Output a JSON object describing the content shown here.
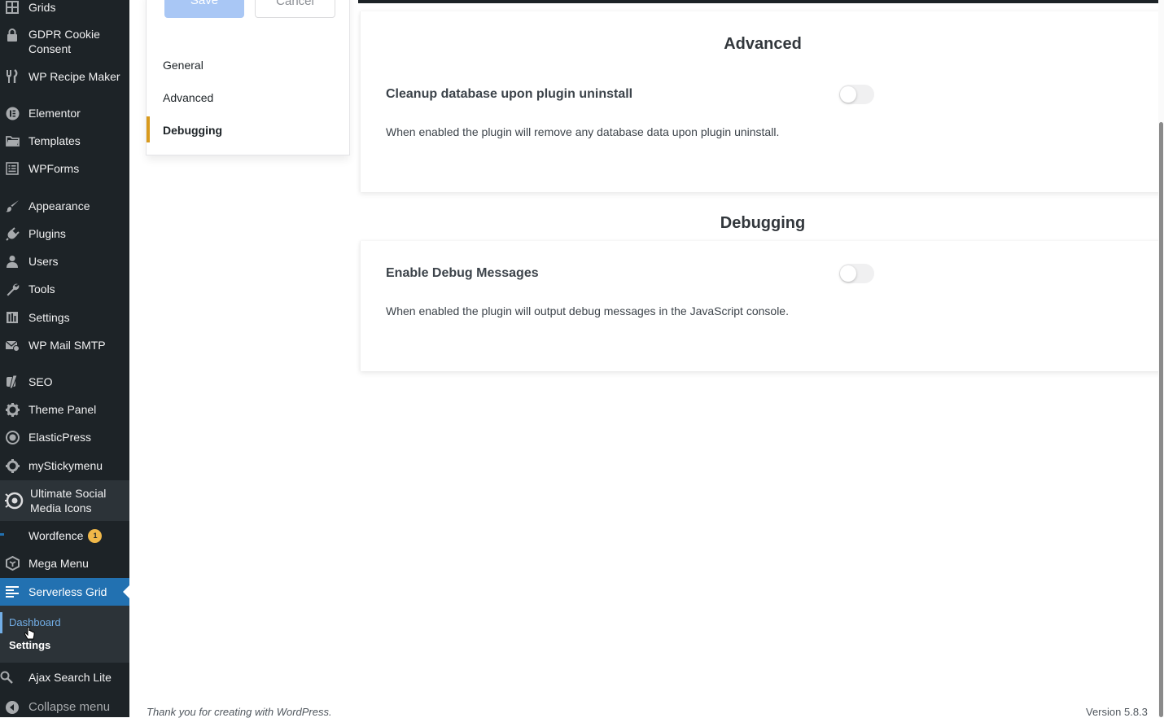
{
  "sidebar": {
    "items": [
      {
        "label": "Grids",
        "icon": "grid-icon"
      },
      {
        "label": "GDPR Cookie Consent",
        "icon": "lock-icon"
      },
      {
        "label": "WP Recipe Maker",
        "icon": "utensils-icon"
      },
      {
        "label": "Elementor",
        "icon": "elementor-icon"
      },
      {
        "label": "Templates",
        "icon": "folder-icon"
      },
      {
        "label": "WPForms",
        "icon": "form-icon"
      },
      {
        "label": "Appearance",
        "icon": "paintbrush-icon"
      },
      {
        "label": "Plugins",
        "icon": "plug-icon"
      },
      {
        "label": "Users",
        "icon": "user-icon"
      },
      {
        "label": "Tools",
        "icon": "wrench-icon"
      },
      {
        "label": "Settings",
        "icon": "settings-icon"
      },
      {
        "label": "WP Mail SMTP",
        "icon": "mail-icon"
      },
      {
        "label": "SEO",
        "icon": "yoast-icon"
      },
      {
        "label": "Theme Panel",
        "icon": "gear-icon"
      },
      {
        "label": "ElasticPress",
        "icon": "elasticpress-icon"
      },
      {
        "label": "myStickymenu",
        "icon": "gear-icon"
      },
      {
        "label": "Ultimate Social Media Icons",
        "icon": "social-icon"
      },
      {
        "label": "Wordfence",
        "icon": "wordfence-icon",
        "badge": "1"
      },
      {
        "label": "Mega Menu",
        "icon": "megamenu-icon"
      },
      {
        "label": "Serverless Grid",
        "icon": "list-icon"
      },
      {
        "label": "Ajax Search Lite",
        "icon": "search-icon"
      },
      {
        "label": "Collapse menu",
        "icon": "collapse-icon"
      }
    ],
    "submenu": [
      {
        "label": "Dashboard"
      },
      {
        "label": "Settings"
      }
    ]
  },
  "settings_nav": {
    "save_label": "Save",
    "cancel_label": "Cancel",
    "items": [
      {
        "label": "General"
      },
      {
        "label": "Advanced"
      },
      {
        "label": "Debugging"
      }
    ]
  },
  "sections": [
    {
      "heading": "Advanced",
      "setting_title": "Cleanup database upon plugin uninstall",
      "setting_desc": "When enabled the plugin will remove any database data upon plugin uninstall.",
      "enabled": false
    },
    {
      "heading": "Debugging",
      "setting_title": "Enable Debug Messages",
      "setting_desc": "When enabled the plugin will output debug messages in the JavaScript console.",
      "enabled": false
    }
  ],
  "footer": {
    "thanks": "Thank you for creating with WordPress.",
    "version": "Version 5.8.3"
  },
  "colors": {
    "sidebar_bg": "#1d2327",
    "active_menu": "#2271b1",
    "nav_current_bar": "#d99a1d",
    "save_button": "#a9c7f5",
    "badge": "#f0b849"
  }
}
